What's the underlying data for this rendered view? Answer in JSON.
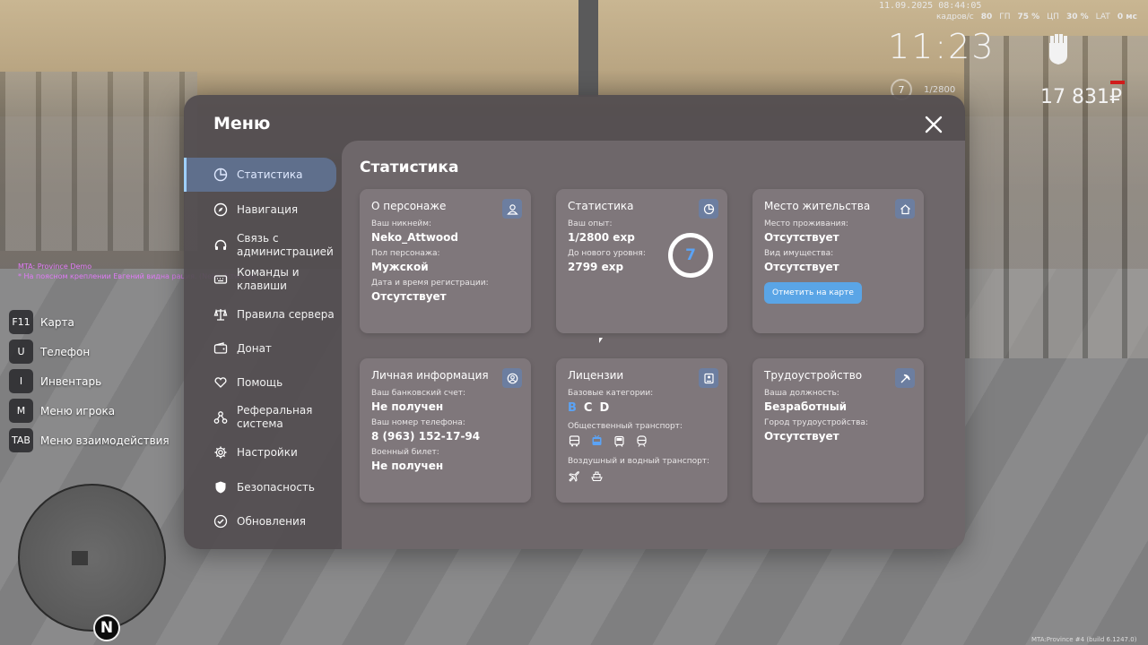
{
  "hud": {
    "datetime": "11.09.2025 08:44:05",
    "fps_label": "кадров/с",
    "fps_value": "80",
    "gpu_label": "ГП",
    "gpu_value": "75 %",
    "cpu_label": "ЦП",
    "cpu_value": "30 %",
    "lat_label": "LAT",
    "lat_value": "0 мс",
    "time": "11:23",
    "level": "7",
    "exp": "1/2800",
    "money": "17 831₽"
  },
  "chat": [
    "MTA: Province Demo",
    "* На поясном креплении Евгений видна рация. (Neko_Attwood)"
  ],
  "keybinds": [
    {
      "key": "F11",
      "label": "Карта"
    },
    {
      "key": "U",
      "label": "Телефон"
    },
    {
      "key": "I",
      "label": "Инвентарь"
    },
    {
      "key": "M",
      "label": "Меню игрока"
    },
    {
      "key": "TAB",
      "label": "Меню взаимодействия"
    }
  ],
  "minimap": {
    "north": "N"
  },
  "build_text": "MTA:Province #4 (build 6.1247.0)",
  "menu": {
    "title": "Меню",
    "nav": [
      {
        "label": "Статистика",
        "icon": "pie-chart-icon"
      },
      {
        "label": "Навигация",
        "icon": "compass-icon"
      },
      {
        "label": "Связь с администрацией",
        "icon": "headset-icon"
      },
      {
        "label": "Команды и клавиши",
        "icon": "keyboard-icon"
      },
      {
        "label": "Правила сервера",
        "icon": "scales-icon"
      },
      {
        "label": "Донат",
        "icon": "wallet-icon"
      },
      {
        "label": "Помощь",
        "icon": "heart-hands-icon"
      },
      {
        "label": "Реферальная система",
        "icon": "referral-icon"
      },
      {
        "label": "Настройки",
        "icon": "gear-icon"
      },
      {
        "label": "Безопасность",
        "icon": "shield-icon"
      },
      {
        "label": "Обновления",
        "icon": "check-circle-icon"
      }
    ],
    "active_nav": 0,
    "page_title": "Статистика",
    "cards": {
      "character": {
        "title": "О персонаже",
        "nick_label": "Ваш никнейм:",
        "nick": "Neko_Attwood",
        "gender_label": "Пол персонажа:",
        "gender": "Мужской",
        "reg_label": "Дата и время регистрации:",
        "reg": "Отсутствует"
      },
      "stats": {
        "title": "Статистика",
        "exp_label": "Ваш опыт:",
        "exp": "1/2800 exp",
        "next_label": "До нового уровня:",
        "next": "2799 exp",
        "level": "7"
      },
      "residence": {
        "title": "Место жительства",
        "place_label": "Место проживания:",
        "place": "Отсутствует",
        "type_label": "Вид имущества:",
        "type": "Отсутствует",
        "button": "Отметить на карте"
      },
      "personal": {
        "title": "Личная информация",
        "bank_label": "Ваш банковский счет:",
        "bank": "Не получен",
        "phone_label": "Ваш номер телефона:",
        "phone": "8 (963) 152-17-94",
        "military_label": "Военный билет:",
        "military": "Не получен"
      },
      "licenses": {
        "title": "Лицензии",
        "base_label": "Базовые категории:",
        "categories": [
          "B",
          "C",
          "D"
        ],
        "public_label": "Общественный транспорт:",
        "air_label": "Воздушный и водный транспорт:"
      },
      "employment": {
        "title": "Трудоустройство",
        "position_label": "Ваша должность:",
        "position": "Безработный",
        "city_label": "Город трудоустройства:",
        "city": "Отсутствует"
      }
    }
  },
  "colors": {
    "accent": "#5ba3f5",
    "active_nav_bg": "#5f6f8c",
    "button": "#5aa5e6",
    "money_bar": "#d01c1c"
  }
}
